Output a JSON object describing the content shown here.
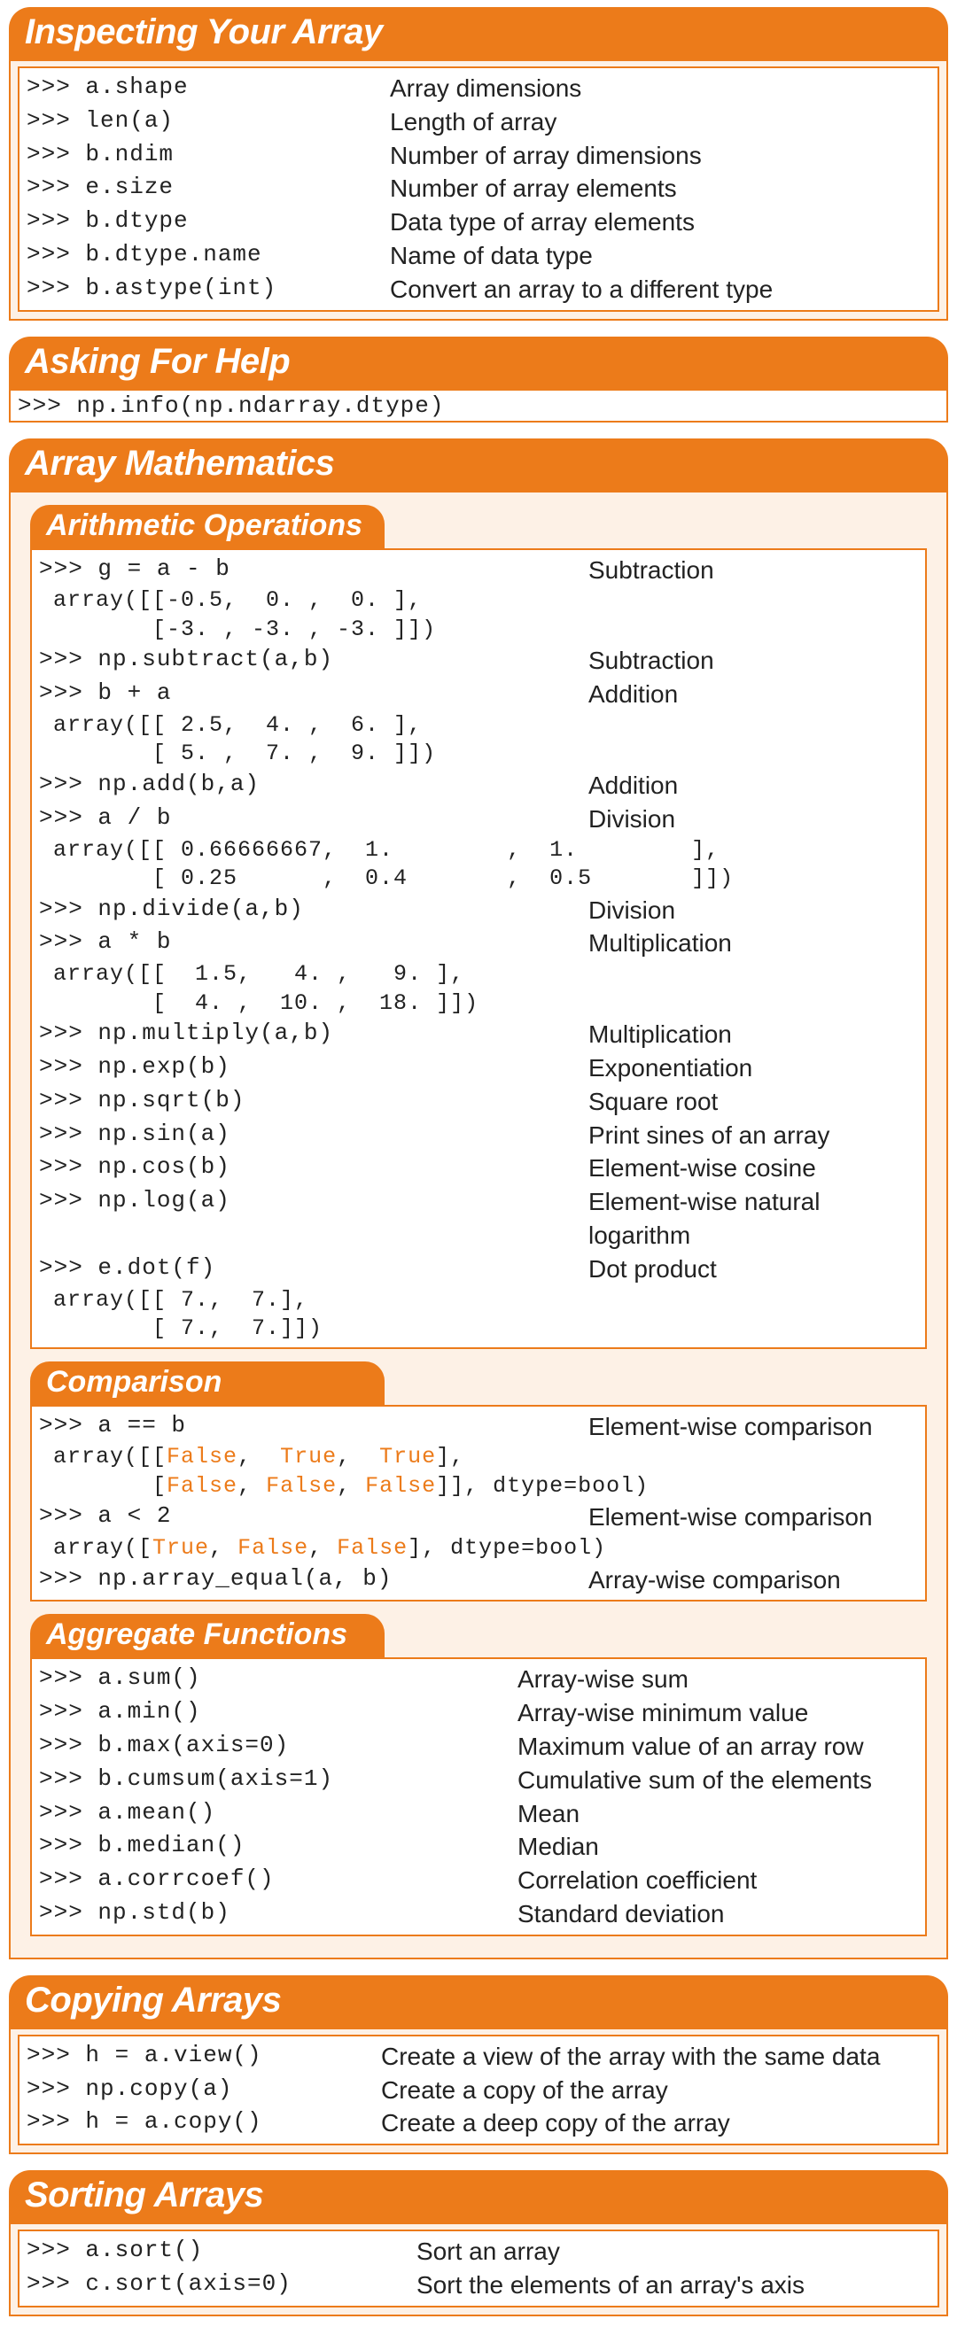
{
  "sections": {
    "inspecting": {
      "title": "Inspecting Your Array",
      "rows": [
        {
          "code": ">>> a.shape",
          "desc": "Array dimensions"
        },
        {
          "code": ">>> len(a)",
          "desc": "Length of array"
        },
        {
          "code": ">>> b.ndim",
          "desc": "Number of array dimensions"
        },
        {
          "code": ">>> e.size",
          "desc": "Number of array elements"
        },
        {
          "code": ">>> b.dtype",
          "desc": "Data type of array elements"
        },
        {
          "code": ">>> b.dtype.name",
          "desc": "Name of data type"
        },
        {
          "code": ">>> b.astype(int)",
          "desc": "Convert an array to a different type"
        }
      ]
    },
    "asking": {
      "title": "Asking For Help",
      "code": ">>> np.info(np.ndarray.dtype)"
    },
    "math": {
      "title": "Array Mathematics",
      "arithmetic": {
        "title": "Arithmetic Operations",
        "items": [
          {
            "code": ">>> g = a - b",
            "desc": "Subtraction",
            "out": [
              " array([[-0.5,  0. ,  0. ],",
              "        [-3. , -3. , -3. ]])"
            ]
          },
          {
            "code": ">>> np.subtract(a,b)",
            "desc": "Subtraction"
          },
          {
            "code": ">>> b + a",
            "desc": "Addition",
            "out": [
              " array([[ 2.5,  4. ,  6. ],",
              "        [ 5. ,  7. ,  9. ]])"
            ]
          },
          {
            "code": ">>> np.add(b,a)",
            "desc": "Addition"
          },
          {
            "code": ">>> a / b",
            "desc": "Division",
            "out": [
              " array([[ 0.66666667,  1.        ,  1.        ],",
              "        [ 0.25      ,  0.4       ,  0.5       ]])"
            ]
          },
          {
            "code": ">>> np.divide(a,b)",
            "desc": "Division"
          },
          {
            "code": ">>> a * b",
            "desc": "Multiplication",
            "out": [
              " array([[  1.5,   4. ,   9. ],",
              "        [  4. ,  10. ,  18. ]])"
            ]
          },
          {
            "code": ">>> np.multiply(a,b)",
            "desc": "Multiplication"
          },
          {
            "code": ">>> np.exp(b)",
            "desc": "Exponentiation"
          },
          {
            "code": ">>> np.sqrt(b)",
            "desc": "Square root"
          },
          {
            "code": ">>> np.sin(a)",
            "desc": "Print sines of an array"
          },
          {
            "code": ">>> np.cos(b)",
            "desc": "Element-wise cosine"
          },
          {
            "code": ">>> np.log(a)",
            "desc": "Element-wise natural logarithm"
          },
          {
            "code": ">>> e.dot(f)",
            "desc": "Dot product",
            "out": [
              " array([[ 7.,  7.],",
              "        [ 7.,  7.]])"
            ]
          }
        ]
      },
      "comparison": {
        "title": "Comparison",
        "items": [
          {
            "code": ">>> a == b",
            "desc": "Element-wise comparison",
            "out_html": [
              " array([[<span class=\"orange-text\">False</span>,  <span class=\"orange-text\">True</span>,  <span class=\"orange-text\">True</span>],",
              "        [<span class=\"orange-text\">False</span>, <span class=\"orange-text\">False</span>, <span class=\"orange-text\">False</span>]], dtype=bool)"
            ]
          },
          {
            "code": ">>> a < 2",
            "desc": "Element-wise comparison",
            "out_html": [
              " array([<span class=\"orange-text\">True</span>, <span class=\"orange-text\">False</span>, <span class=\"orange-text\">False</span>], dtype=bool)"
            ]
          },
          {
            "code": ">>> np.array_equal(a, b)",
            "desc": "Array-wise comparison"
          }
        ]
      },
      "aggregate": {
        "title": "Aggregate Functions",
        "rows": [
          {
            "code": ">>> a.sum()",
            "desc": "Array-wise sum"
          },
          {
            "code": ">>> a.min()",
            "desc": "Array-wise minimum value"
          },
          {
            "code": ">>> b.max(axis=0)",
            "desc": "Maximum value of an array row"
          },
          {
            "code": ">>> b.cumsum(axis=1)",
            "desc": "Cumulative sum of the elements"
          },
          {
            "code": ">>> a.mean()",
            "desc": "Mean"
          },
          {
            "code": ">>> b.median()",
            "desc": "Median"
          },
          {
            "code": ">>> a.corrcoef()",
            "desc": "Correlation coefficient"
          },
          {
            "code": ">>> np.std(b)",
            "desc": "Standard deviation"
          }
        ]
      }
    },
    "copying": {
      "title": "Copying Arrays",
      "rows": [
        {
          "code": ">>> h = a.view()",
          "desc": "Create a view of the array with the same data"
        },
        {
          "code": ">>> np.copy(a)",
          "desc": "Create a copy of the array"
        },
        {
          "code": ">>> h = a.copy()",
          "desc": "Create a deep copy of the array"
        }
      ]
    },
    "sorting": {
      "title": "Sorting Arrays",
      "rows": [
        {
          "code": ">>> a.sort()",
          "desc": "Sort an array"
        },
        {
          "code": ">>> c.sort(axis=0)",
          "desc": "Sort the elements of an array's axis"
        }
      ]
    }
  }
}
